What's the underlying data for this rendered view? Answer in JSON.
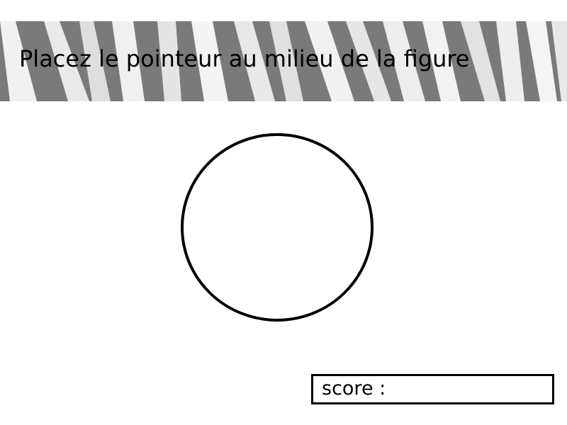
{
  "game": {
    "instruction": "Placez le pointeur au milieu de la figure",
    "target_shape": "circle",
    "score_label": "score :",
    "score_value": ""
  },
  "colors": {
    "background": "#ffffff",
    "text": "#000000",
    "shape_stroke": "#000000",
    "banner_dark": "#6e6e6e",
    "banner_light": "#f2f2f2"
  }
}
